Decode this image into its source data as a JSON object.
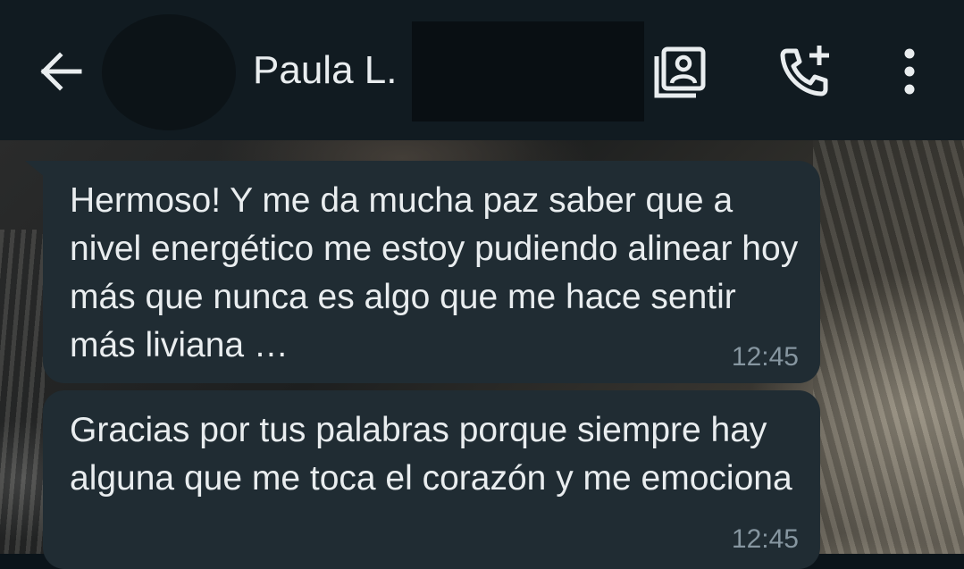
{
  "header": {
    "contact_name": "Paula L.",
    "icons": {
      "back": "arrow-left-icon",
      "contact_card": "contact-card-icon",
      "add_call": "add-call-icon",
      "more": "more-vertical-icon"
    },
    "colors": {
      "background": "#111b21",
      "text": "#e9edef"
    }
  },
  "messages": [
    {
      "text": "Hermoso! Y me da mucha paz saber que a nivel energético me estoy pudiendo alinear hoy más que nunca es algo que me hace sentir más liviana …",
      "time": "12:45"
    },
    {
      "text": "Gracias por tus palabras porque siempre hay alguna que me toca el corazón y me emociona",
      "time": "12:45"
    }
  ],
  "colors": {
    "bubble": "#202c33",
    "timestamp": "#8696a0"
  }
}
